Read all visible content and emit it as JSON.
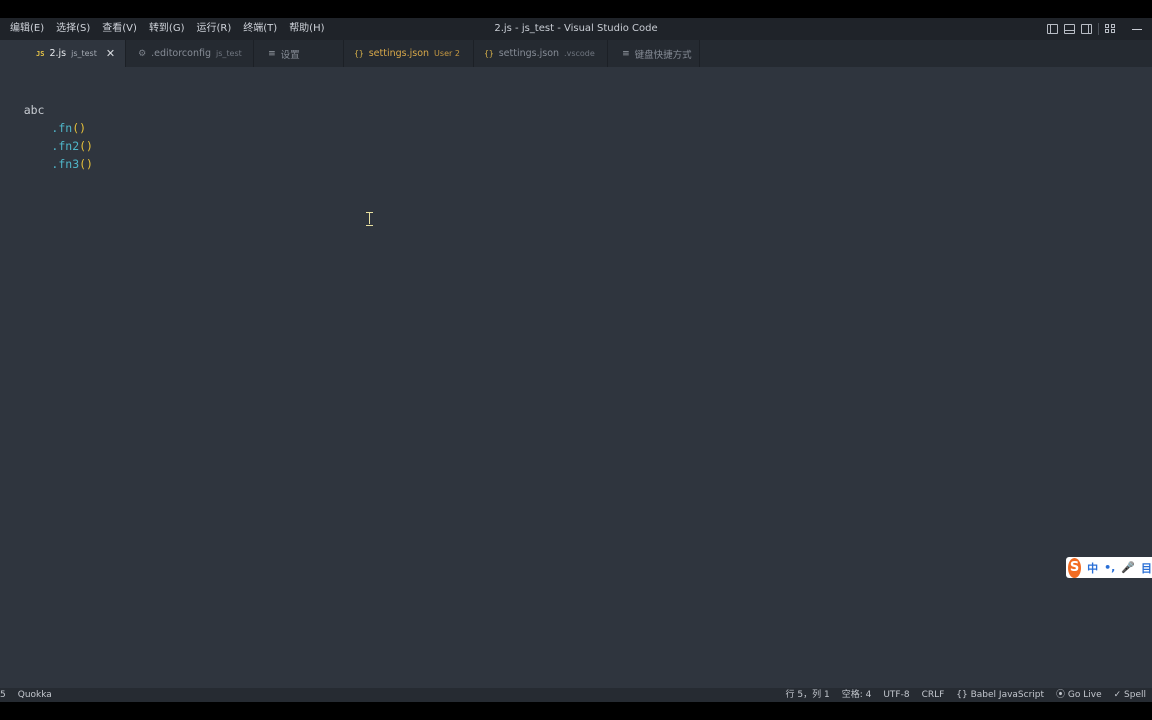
{
  "window": {
    "title": "2.js - js_test - Visual Studio Code"
  },
  "menu": {
    "items": [
      {
        "label": "编辑(E)"
      },
      {
        "label": "选择(S)"
      },
      {
        "label": "查看(V)"
      },
      {
        "label": "转到(G)"
      },
      {
        "label": "运行(R)"
      },
      {
        "label": "终端(T)"
      },
      {
        "label": "帮助(H)"
      }
    ]
  },
  "tabs": [
    {
      "icon": "JS",
      "name": "2.js",
      "desc": "js_test",
      "active": true,
      "close": "✕"
    },
    {
      "icon": "⚙",
      "name": ".editorconfig",
      "desc": "js_test"
    },
    {
      "icon": "≡",
      "name": "设置",
      "desc": ""
    },
    {
      "icon": "{}",
      "name": "settings.json",
      "desc": "User 2",
      "modified": true
    },
    {
      "icon": "{}",
      "name": "settings.json",
      "desc": ".vscode"
    },
    {
      "icon": "≡",
      "name": "键盘快捷方式",
      "desc": ""
    }
  ],
  "editor": {
    "lines": [
      {
        "ident": "abc"
      },
      {
        "indent": "    ",
        "dot": ".",
        "fn": "fn",
        "parens": "()"
      },
      {
        "indent": "    ",
        "dot": ".",
        "fn": "fn2",
        "parens": "()"
      },
      {
        "indent": "    ",
        "dot": ".",
        "fn": "fn3",
        "parens": "()"
      }
    ]
  },
  "ime": {
    "logo": "S",
    "lang": "中",
    "punct": "•,",
    "mic": "🎤",
    "extra": "目"
  },
  "statusbar": {
    "left": [
      "5",
      "Quokka"
    ],
    "right": [
      "行 5，列 1",
      "空格: 4",
      "UTF-8",
      "CRLF",
      "{} Babel JavaScript",
      "⦿ Go Live",
      "✓ Spell"
    ]
  },
  "colors": {
    "editor_bg": "#2f353e",
    "tabbar_bg": "#252a31",
    "titlebar_bg": "#1f2329",
    "statusbar_bg": "#262b32",
    "accent_method": "#4fb6c9",
    "accent_paren": "#e8c23a",
    "ime_logo": "#f26b21"
  }
}
